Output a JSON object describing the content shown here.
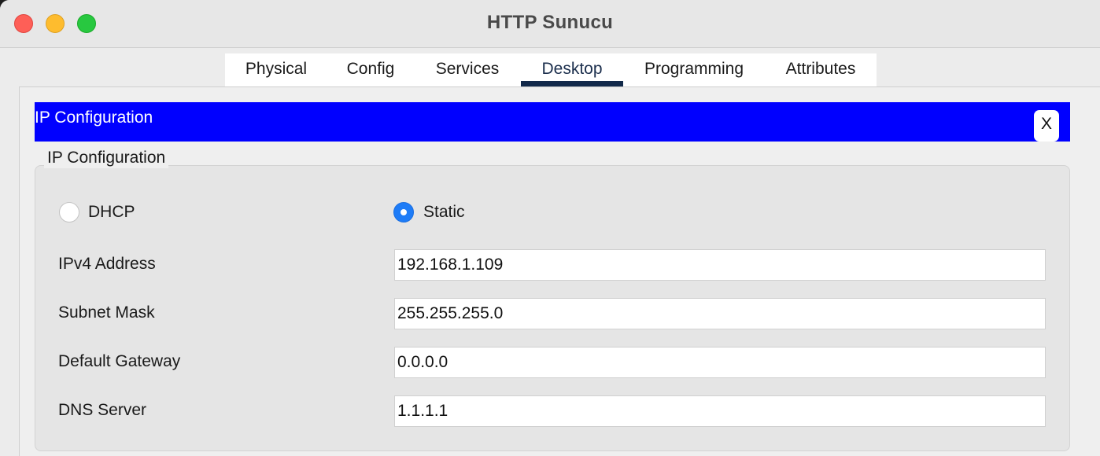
{
  "window": {
    "title": "HTTP Sunucu"
  },
  "tabs": [
    {
      "label": "Physical",
      "active": false
    },
    {
      "label": "Config",
      "active": false
    },
    {
      "label": "Services",
      "active": false
    },
    {
      "label": "Desktop",
      "active": true
    },
    {
      "label": "Programming",
      "active": false
    },
    {
      "label": "Attributes",
      "active": false
    }
  ],
  "panel": {
    "header_title": "IP Configuration",
    "close_label": "X",
    "group_title": "IP Configuration"
  },
  "mode": {
    "dhcp_label": "DHCP",
    "static_label": "Static",
    "selected": "Static"
  },
  "fields": {
    "ipv4": {
      "label": "IPv4 Address",
      "value": "192.168.1.109"
    },
    "subnet": {
      "label": "Subnet Mask",
      "value": "255.255.255.0"
    },
    "gateway": {
      "label": "Default Gateway",
      "value": "0.0.0.0"
    },
    "dns": {
      "label": "DNS Server",
      "value": "1.1.1.1"
    }
  },
  "colors": {
    "header_blue": "#0000ff",
    "radio_selected": "#1e7cf7",
    "active_tab_indicator": "#12294a"
  }
}
